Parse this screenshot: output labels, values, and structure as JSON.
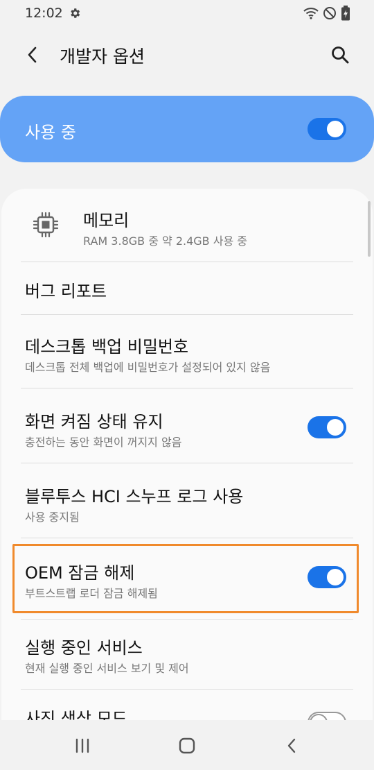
{
  "status_bar": {
    "time": "12:02",
    "icons": [
      "gear-icon",
      "wifi-icon",
      "do-not-disturb-icon",
      "battery-charging-icon"
    ]
  },
  "app_bar": {
    "title": "개발자 옵션",
    "back_icon": "chevron-left-icon",
    "search_icon": "search-icon"
  },
  "master_switch": {
    "label": "사용 중",
    "state": "on",
    "background_color": "#64a3f6"
  },
  "settings": [
    {
      "title": "메모리",
      "subtitle": "RAM 3.8GB 중 약 2.4GB 사용 중",
      "icon": "memory-chip-icon"
    },
    {
      "title": "버그 리포트"
    },
    {
      "title": "데스크톱 백업 비밀번호",
      "subtitle": "데스크톱 전체 백업에 비밀번호가 설정되어 있지 않음"
    },
    {
      "title": "화면 켜짐 상태 유지",
      "subtitle": "충전하는 동안 화면이 꺼지지 않음",
      "toggle": "on"
    },
    {
      "title": "블루투스 HCI 스누프 로그 사용",
      "subtitle": "사용 중지됨"
    },
    {
      "title": "OEM 잠금 해제",
      "subtitle": "부트스트랩 로더 잠금 해제됨",
      "toggle": "on",
      "highlighted": true
    },
    {
      "title": "실행 중인 서비스",
      "subtitle": "현재 실행 중인 서비스 보기 및 제어"
    },
    {
      "title": "사진 색상 모드",
      "toggle": "off"
    }
  ],
  "colors": {
    "accent": "#1a73e8",
    "highlight_border": "#f08a2c"
  },
  "nav_bar": {
    "icons": [
      "recent-apps-icon",
      "home-icon",
      "back-icon"
    ]
  }
}
